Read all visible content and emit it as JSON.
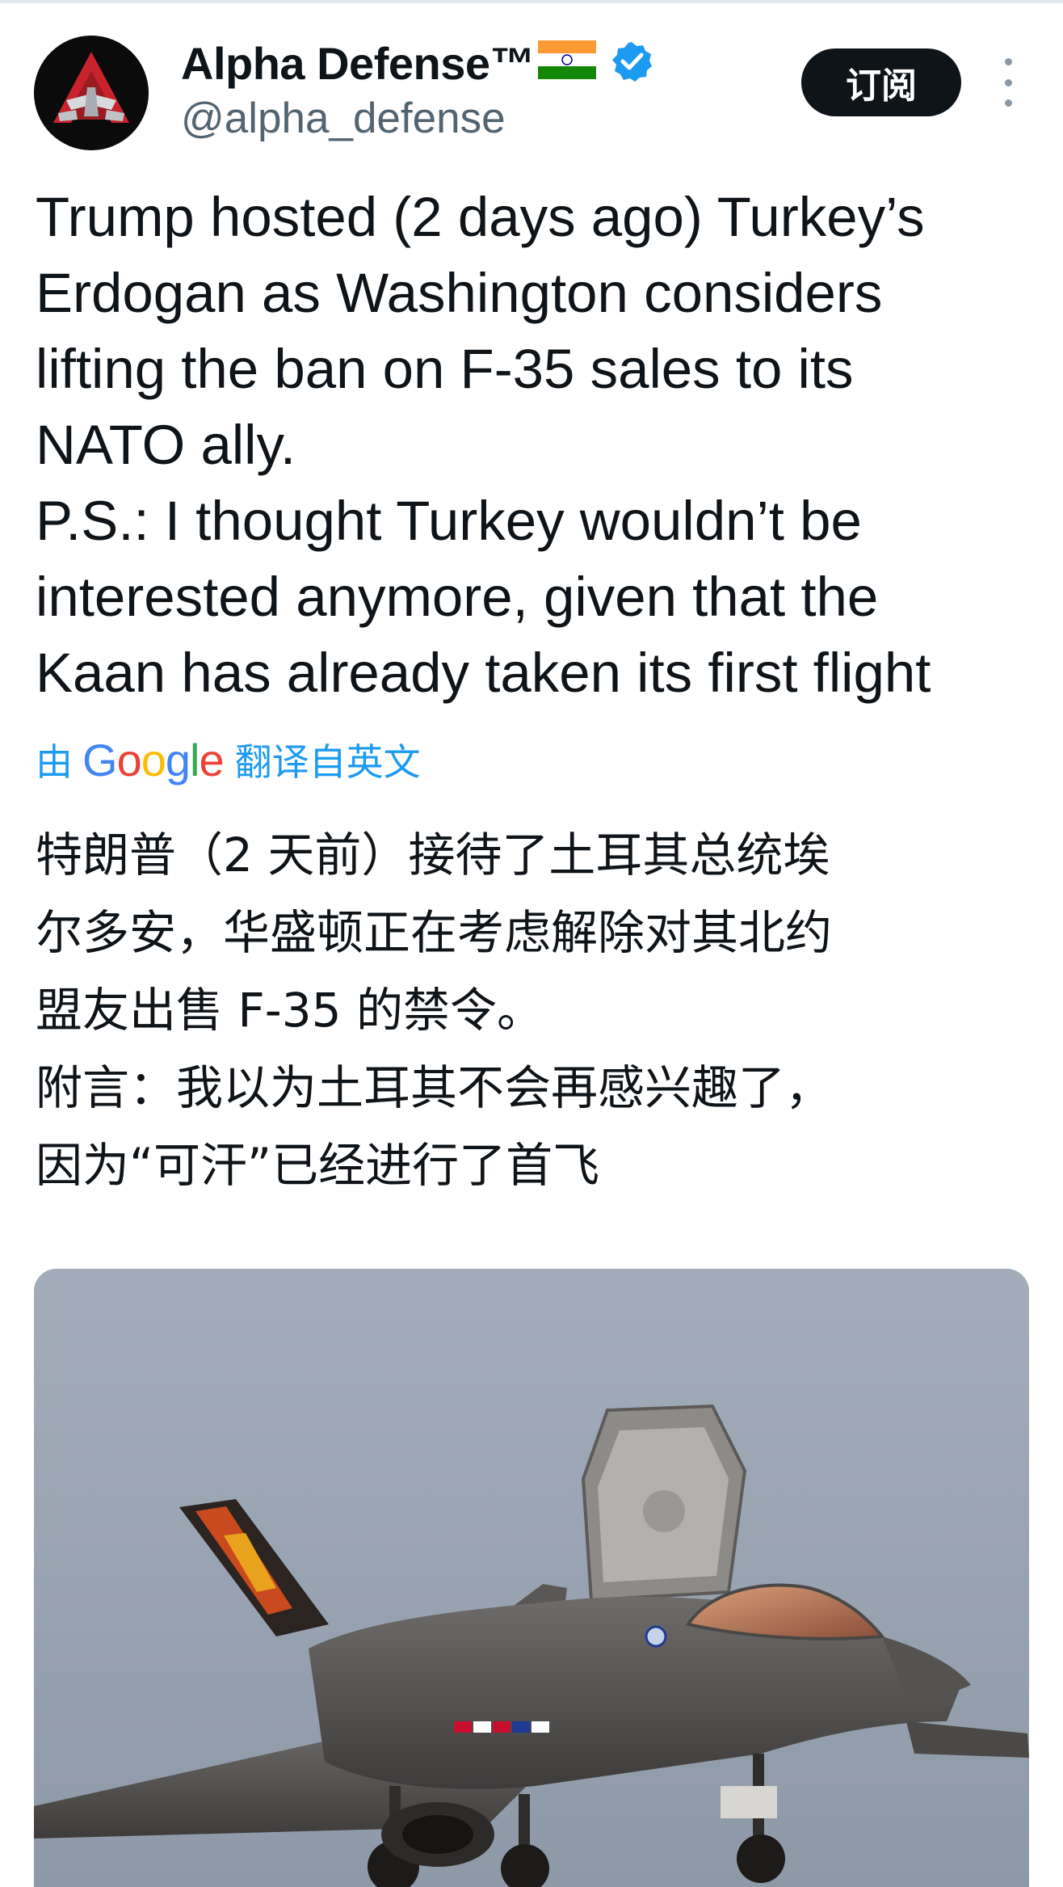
{
  "author": {
    "display_name": "Alpha Defense™",
    "handle": "@alpha_defense",
    "flag_icon": "india-flag-icon",
    "verified_icon": "verified-badge-icon",
    "verified_color": "#1d9bf0"
  },
  "actions": {
    "subscribe_label": "订阅",
    "more_icon": "more-vertical-icon"
  },
  "tweet": {
    "lines": [
      "Trump hosted (2 days ago) Turkey’s",
      "Erdogan as Washington considers",
      "lifting the ban on F-35 sales to its",
      "NATO ally.",
      "P.S.: I thought Turkey wouldn’t be",
      "interested anymore, given that the",
      "Kaan has already taken its first flight"
    ]
  },
  "translation": {
    "prefix": "由",
    "provider_letters": [
      "G",
      "o",
      "o",
      "g",
      "l",
      "e"
    ],
    "suffix": "翻译自英文",
    "link_color": "#1d9bf0",
    "lines": [
      "特朗普（2 天前）接待了土耳其总统埃",
      "尔多安，华盛顿正在考虑解除对其北约",
      "盟友出售 F-35 的禁令。",
      "附言：我以为土耳其不会再感兴趣了，",
      "因为“可汗”已经进行了首飞"
    ]
  },
  "media": {
    "type": "photo",
    "subject": "fighter-jet-photo"
  }
}
